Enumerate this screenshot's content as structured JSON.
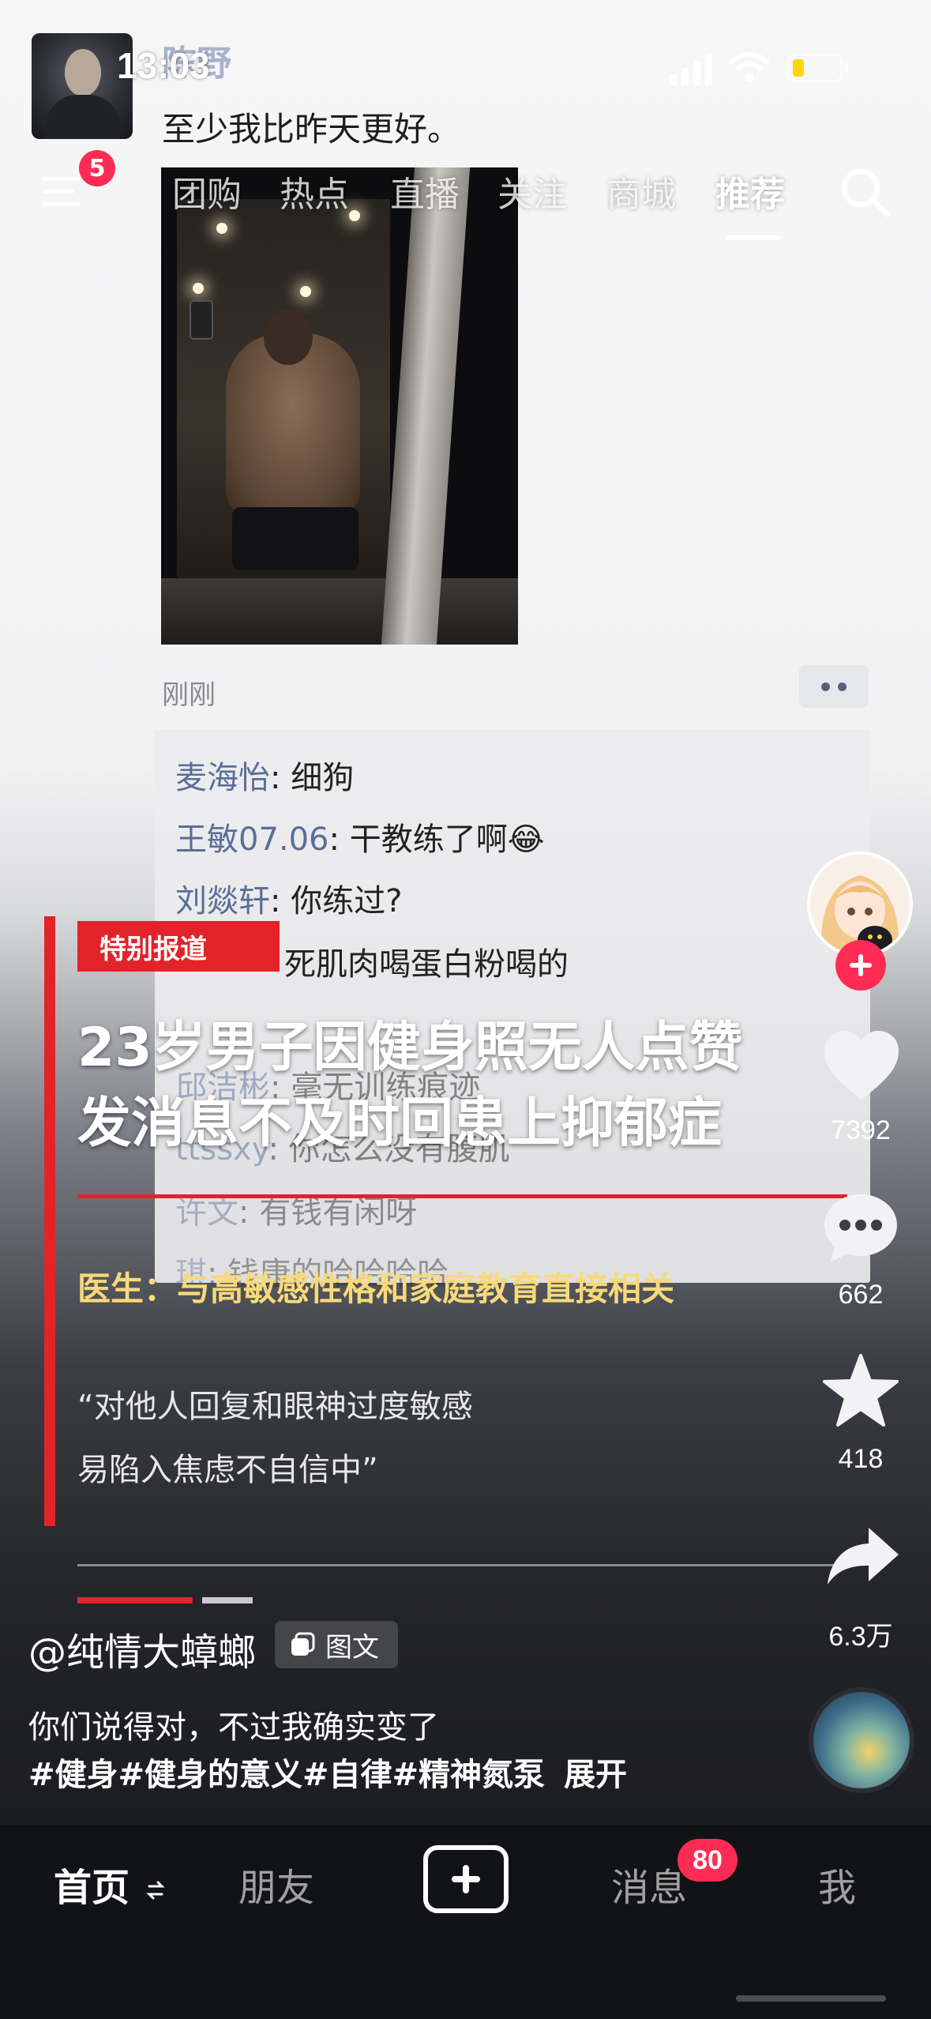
{
  "status_bar": {
    "time": "13:03"
  },
  "post": {
    "poster_name": "陈野",
    "text": "至少我比昨天更好。",
    "time": "刚刚",
    "comments": [
      {
        "name": "麦海怡",
        "text": ": 细狗"
      },
      {
        "name": "王敏07.06",
        "text": ": 干教练了啊😂"
      },
      {
        "name": "刘燚轩",
        "text": ": 你练过?"
      },
      {
        "name": "",
        "text": "死肌肉喝蛋白粉喝的"
      },
      {
        "name": "邱洁彬",
        "text": ": 毫无训练痕迹"
      },
      {
        "name": "ttssxy",
        "text": ": 你怎么没有腹肌"
      },
      {
        "name": "许文",
        "text": ": 有钱有闲呀"
      },
      {
        "name": "琪",
        "text": ": 钱康的哈哈哈哈"
      }
    ]
  },
  "top_nav": {
    "menu_badge": "5",
    "tabs": [
      "团购",
      "热点",
      "直播",
      "关注",
      "商城",
      "推荐"
    ],
    "active_tab": "推荐"
  },
  "overlay": {
    "tag": "特别报道",
    "headline_1": "23岁男子因健身照无人点赞",
    "headline_2": "发消息不及时回患上抑郁症",
    "doctor": "医生：与高敏感性格和家庭教育直接相关",
    "quote_1": "“对他人回复和眼神过度敏感",
    "quote_2": "易陷入焦虑不自信中”"
  },
  "actions": {
    "likes": "7392",
    "comments": "662",
    "favorites": "418",
    "shares": "6.3万"
  },
  "caption": {
    "author": "@纯情大蟑螂",
    "type_chip": "图文",
    "line1": "你们说得对，不过我确实变了",
    "tags": "#健身#健身的意义#自律#精神氮泵",
    "expand": "展开"
  },
  "bottom_nav": {
    "home": "首页",
    "friends": "朋友",
    "messages": "消息",
    "messages_badge": "80",
    "me": "我"
  },
  "colors": {
    "accent_red": "#fe2c55",
    "overlay_red": "#e2232a",
    "doctor_yellow": "#f7d979"
  }
}
